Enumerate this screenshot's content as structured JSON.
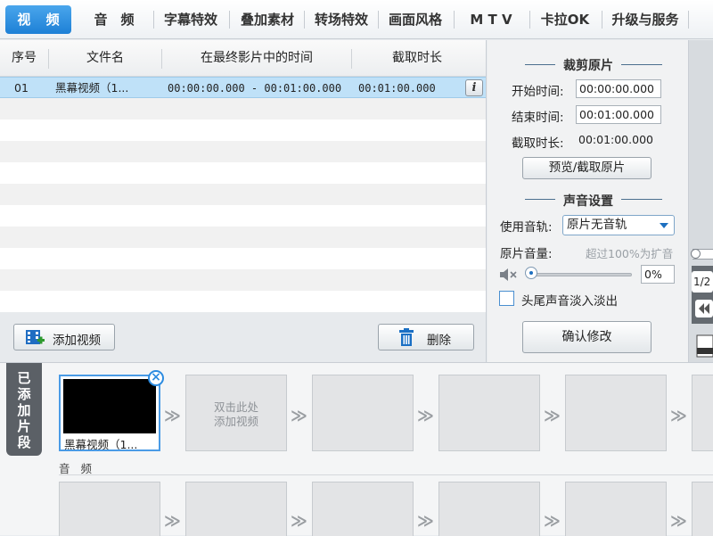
{
  "tabs": [
    {
      "label": "视 频"
    },
    {
      "label": "音　频"
    },
    {
      "label": "字幕特效"
    },
    {
      "label": "叠加素材"
    },
    {
      "label": "转场特效"
    },
    {
      "label": "画面风格"
    },
    {
      "label": "M T V"
    },
    {
      "label": "卡拉OK"
    },
    {
      "label": "升级与服务"
    }
  ],
  "table": {
    "headers": [
      "序号",
      "文件名",
      "在最终影片中的时间",
      "截取时长"
    ],
    "rows": [
      {
        "index": "01",
        "filename": "黑幕视频（1...",
        "time_range": "00:00:00.000 - 00:01:00.000",
        "duration": "00:01:00.000"
      }
    ],
    "info_icon": "i"
  },
  "left_buttons": {
    "add_video": "添加视频",
    "delete": "删除"
  },
  "crop": {
    "title": "裁剪原片",
    "start_label": "开始时间:",
    "start_value": "00:00:00.000",
    "end_label": "结束时间:",
    "end_value": "00:01:00.000",
    "duration_label": "截取时长:",
    "duration_value": "00:01:00.000",
    "preview_button": "预览/截取原片"
  },
  "audio": {
    "title": "声音设置",
    "track_label": "使用音轨:",
    "track_value": "原片无音轨",
    "volume_label": "原片音量:",
    "volume_hint": "超过100%为扩音",
    "volume_value": "0%",
    "fade_label": "头尾声音淡入淡出",
    "fade_checked": false
  },
  "confirm_button": "确认修改",
  "strip": {
    "page": "1/2"
  },
  "timeline": {
    "video_section_label": "已添加片段",
    "first_clip_caption": "黑幕视频（1...",
    "placeholder_text": "双击此处\n添加视频",
    "audio_label": "音 频"
  },
  "colors": {
    "accent": "#1d80d6",
    "selected_row": "#bfe1f8",
    "delete_icon": "#1a6fc4"
  }
}
